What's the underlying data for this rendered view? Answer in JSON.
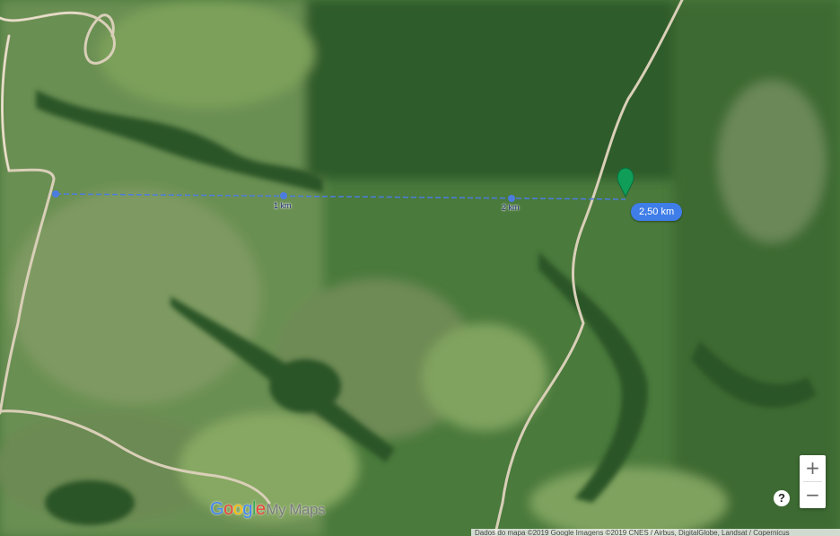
{
  "map": {
    "type": "satellite",
    "measure": {
      "km_labels": [
        "1 km",
        "2 km"
      ],
      "total_distance": "2,50 km",
      "line_color": "#3f7de8"
    },
    "marker": {
      "color": "#0f9d58",
      "icon": "map-pin-icon"
    }
  },
  "controls": {
    "zoom_in": "+",
    "zoom_out": "−",
    "help": "?"
  },
  "branding": {
    "logo_letters": [
      "G",
      "o",
      "o",
      "g",
      "l",
      "e"
    ],
    "product": "My Maps"
  },
  "attribution": "Dados do mapa ©2019 Google Imagens ©2019 CNES / Airbus, DigitalGlobe, Landsat / Copernicus"
}
